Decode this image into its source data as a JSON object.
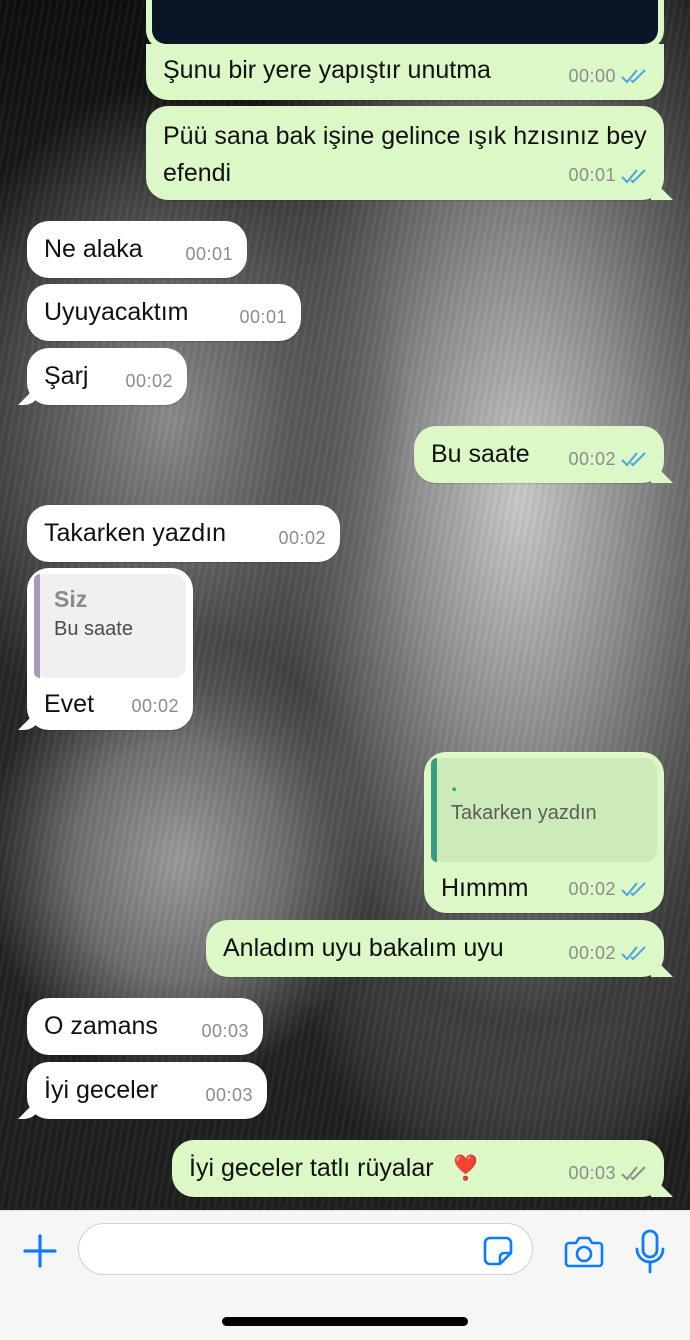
{
  "messages": [
    {
      "id": "m1",
      "dir": "out",
      "text": "Şunu bir yere yapıştır unutma",
      "time": "00:00",
      "status": "read"
    },
    {
      "id": "m2",
      "dir": "out",
      "text": "Püü sana bak işine gelince ışık hzısınız bey efendi",
      "time": "00:01",
      "status": "read"
    },
    {
      "id": "m3",
      "dir": "in",
      "text": "Ne alaka",
      "time": "00:01"
    },
    {
      "id": "m4",
      "dir": "in",
      "text": "Uyuyacaktım",
      "time": "00:01"
    },
    {
      "id": "m5",
      "dir": "in",
      "text": "Şarj",
      "time": "00:02"
    },
    {
      "id": "m6",
      "dir": "out",
      "text": "Bu saate",
      "time": "00:02",
      "status": "read"
    },
    {
      "id": "m7",
      "dir": "in",
      "text": "Takarken yazdın",
      "time": "00:02"
    },
    {
      "id": "m8",
      "dir": "in",
      "text": "Evet",
      "time": "00:02",
      "reply": {
        "author": "Siz",
        "text": "Bu saate"
      }
    },
    {
      "id": "m9",
      "dir": "out",
      "text": "Hımmm",
      "time": "00:02",
      "status": "read",
      "reply": {
        "author": ".",
        "text": "Takarken yazdın"
      }
    },
    {
      "id": "m10",
      "dir": "out",
      "text": "Anladım uyu bakalım uyu",
      "time": "00:02",
      "status": "read"
    },
    {
      "id": "m11",
      "dir": "in",
      "text": "O zamans",
      "time": "00:03"
    },
    {
      "id": "m12",
      "dir": "in",
      "text": "İyi geceler",
      "time": "00:03"
    },
    {
      "id": "m13",
      "dir": "out",
      "text": "İyi geceler tatlı rüyalar",
      "emoji": "❣️",
      "time": "00:03",
      "status": "delivered"
    }
  ],
  "composer": {
    "placeholder": "",
    "icons": [
      "plus-icon",
      "sticker-icon",
      "camera-icon",
      "microphone-icon"
    ]
  },
  "colors": {
    "incoming_bubble": "#ffffff",
    "outgoing_bubble": "#dbf8c6",
    "read_ticks": "#4fa3e0",
    "delivered_ticks": "#8c8c8c",
    "accent": "#0a7cff"
  }
}
